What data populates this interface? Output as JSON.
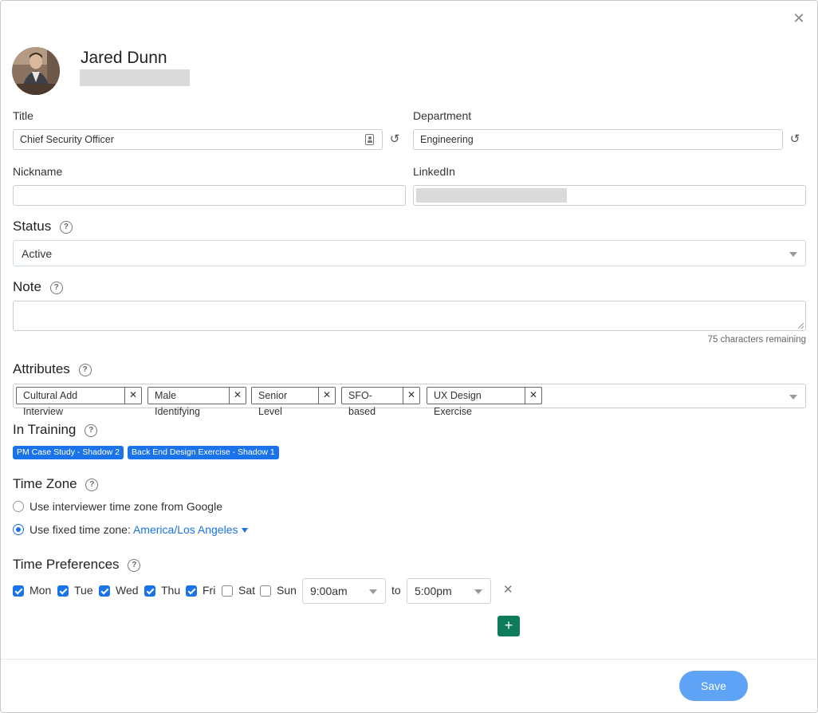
{
  "profile": {
    "name": "Jared Dunn"
  },
  "fields": {
    "title_label": "Title",
    "title_value": "Chief Security Officer",
    "department_label": "Department",
    "department_value": "Engineering",
    "nickname_label": "Nickname",
    "nickname_value": "",
    "linkedin_label": "LinkedIn"
  },
  "status": {
    "label": "Status",
    "value": "Active"
  },
  "note": {
    "label": "Note",
    "value": "",
    "remaining": "75 characters remaining"
  },
  "attributes": {
    "label": "Attributes",
    "tags": [
      "Cultural Add Interview",
      "Male Identifying",
      "Senior Level",
      "SFO-based",
      "UX Design Exercise"
    ]
  },
  "training": {
    "label": "In Training",
    "items": [
      "PM Case Study - Shadow 2",
      "Back End Design Exercise - Shadow 1"
    ]
  },
  "timezone": {
    "label": "Time Zone",
    "option_google": "Use interviewer time zone from Google",
    "option_fixed": "Use fixed time zone:",
    "fixed_value": "America/Los Angeles",
    "selected": "fixed"
  },
  "time_prefs": {
    "label": "Time Preferences",
    "days": [
      {
        "label": "Mon",
        "checked": true
      },
      {
        "label": "Tue",
        "checked": true
      },
      {
        "label": "Wed",
        "checked": true
      },
      {
        "label": "Thu",
        "checked": true
      },
      {
        "label": "Fri",
        "checked": true
      },
      {
        "label": "Sat",
        "checked": false
      },
      {
        "label": "Sun",
        "checked": false
      }
    ],
    "start": "9:00am",
    "to_label": "to",
    "end": "5:00pm"
  },
  "footer": {
    "save_label": "Save"
  },
  "colors": {
    "accent": "#1a73e8",
    "save_button": "#5fa3f7",
    "add_button": "#0e7c5a"
  }
}
